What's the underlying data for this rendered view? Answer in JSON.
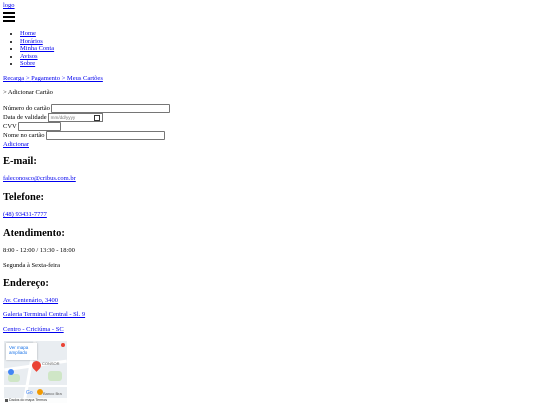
{
  "header": {
    "logo_text": "logo"
  },
  "nav": {
    "items": [
      {
        "label": "Home"
      },
      {
        "label": "Horários"
      },
      {
        "label": "Minha Conta"
      },
      {
        "label": "Avisos"
      },
      {
        "label": "Sobre"
      }
    ]
  },
  "breadcrumb": {
    "links": [
      "Recarga",
      "Pagamento",
      "Meus Cartões"
    ],
    "separator": " > ",
    "current": "> Adicionar Cartão"
  },
  "form": {
    "card_number_label": "Número do cartão",
    "expiry_label": "Data de validade",
    "expiry_placeholder": "mm/dd/yyyy",
    "cvv_label": "CVV",
    "card_name_label": "Nome no cartão",
    "submit_label": "Adicionar"
  },
  "contact": {
    "email_heading": "E-mail:",
    "email": "faleconosco@cribus.com.br",
    "phone_heading": "Telefone:",
    "phone": "(48) 93431-7777",
    "hours_heading": "Atendimento:",
    "hours": "8:00 - 12:00 / 13:30 - 18:00",
    "days": "Segunda à Sexta-feira",
    "address_heading": "Endereço:",
    "address_line1": "Av. Centenário, 3400",
    "address_line2": "Galeria Terminal Central - Sl. 9",
    "address_line3": "Centro - Criciúma - SC"
  },
  "map": {
    "card_text": "Ver mapa ampliado",
    "label_top": "CONSOR",
    "label_bottom": "Banco Bra",
    "google_text": "Go",
    "footer_keys": "Atalhos do teclado",
    "footer_data": "Dados do mapa",
    "footer_terms": "Termos",
    "colors": {
      "pin": "#ea4335",
      "water": "#e9edf1",
      "park": "#cfe6c6"
    }
  }
}
